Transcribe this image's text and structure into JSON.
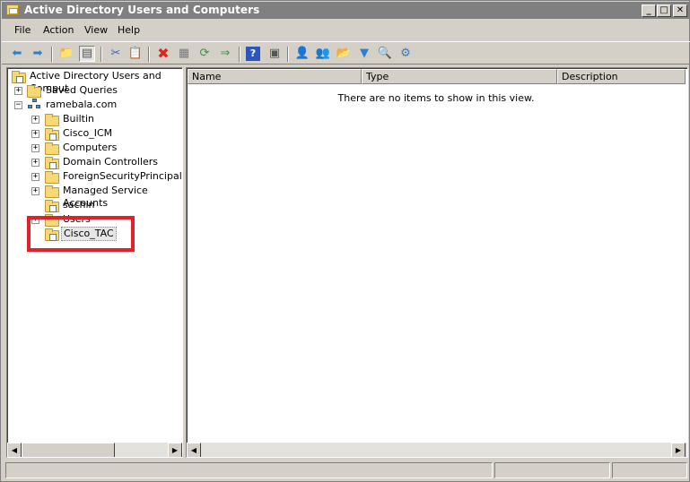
{
  "window": {
    "title": "Active Directory Users and Computers",
    "controls": {
      "minimize": "_",
      "maximize": "□",
      "close": "✕"
    }
  },
  "menu": [
    "File",
    "Action",
    "View",
    "Help"
  ],
  "toolbar": {
    "icons": [
      "back-arrow-icon",
      "forward-arrow-icon",
      "up-folder-icon",
      "show-tree-icon",
      "cut-icon",
      "copy-icon",
      "delete-icon",
      "properties-icon",
      "refresh-icon",
      "export-icon",
      "help-icon",
      "console-view-icon",
      "new-user-icon",
      "new-group-icon",
      "new-ou-icon",
      "filter-icon",
      "find-icon",
      "add-to-group-icon"
    ],
    "colors": {
      "back": "#2f7fd0",
      "forward": "#2f7fd0",
      "delete": "#d62a1e",
      "help": "#2b57b8"
    }
  },
  "tree": {
    "root": "Active Directory Users and Comput",
    "saved_queries": "Saved Queries",
    "domain": "ramebala.com",
    "children": [
      "Builtin",
      "Cisco_ICM",
      "Computers",
      "Domain Controllers",
      "ForeignSecurityPrincipals",
      "Managed Service Accounts",
      "sachin",
      "Users"
    ],
    "selected": "Cisco_TAC",
    "expand_plus": "+",
    "expand_minus": "−"
  },
  "details": {
    "columns": [
      "Name",
      "Type",
      "Description"
    ],
    "empty_message": "There are no items to show in this view."
  },
  "highlight_color": "#e0232b"
}
